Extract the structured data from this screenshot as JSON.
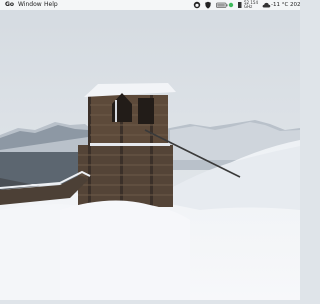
{
  "menubar": {
    "app_name": "Go",
    "menus": [
      "Window",
      "Help"
    ],
    "status": {
      "cpu_top": "52 154",
      "cpu_bottom": "GHz",
      "temperature": "-11 °C",
      "clock": "202"
    }
  },
  "wallpaper": {
    "description_icon": "abandoned-mine-shack-in-snow"
  },
  "colors": {
    "menubar_bg": "#f6f7f9",
    "sky": "#dfe4e9",
    "snow": "#f3f5f8",
    "wood": "#5a4a3c",
    "battery_green": "#3cb95a"
  }
}
